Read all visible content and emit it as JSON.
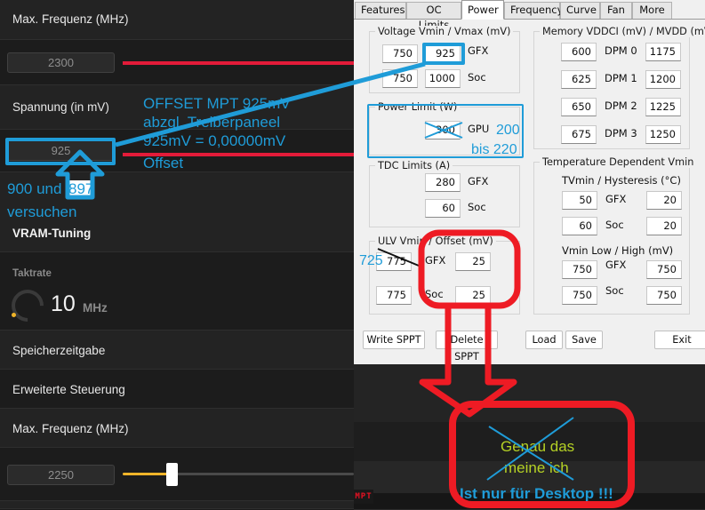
{
  "left_panel": {
    "rows": [
      {
        "label": "Max. Frequenz (MHz)"
      },
      {
        "value": "2300"
      },
      {
        "label": "Spannung (in mV)"
      },
      {
        "value": "925"
      },
      {
        "label": "VRAM-Tuning"
      },
      {
        "label": "Taktrate",
        "value": "10",
        "unit": "MHz"
      },
      {
        "label": "Speicherzeitgabe"
      },
      {
        "label": "Erweiterte Steuerung"
      },
      {
        "label": "Max. Frequenz (MHz)"
      },
      {
        "value": "2250"
      }
    ],
    "max_freq_label_top": "Max. Frequenz (MHz)",
    "max_freq_value_top": "2300",
    "voltage_label": "Spannung (in mV)",
    "voltage_value": "925",
    "vram_tuning_label": "VRAM-Tuning",
    "taktrate_label": "Taktrate",
    "taktrate_value": "10",
    "taktrate_unit": "MHz",
    "memory_timing_label": "Speicherzeitgabe",
    "advanced_control_label": "Erweiterte Steuerung",
    "max_freq_label_bottom": "Max. Frequenz (MHz)",
    "max_freq_value_bottom": "2250"
  },
  "mpt": {
    "tabs": [
      {
        "label": "Features",
        "selected": false
      },
      {
        "label": "OC Limits",
        "selected": false
      },
      {
        "label": "Power",
        "selected": true
      },
      {
        "label": "Frequency",
        "selected": false
      },
      {
        "label": "Curve",
        "selected": false
      },
      {
        "label": "Fan",
        "selected": false
      },
      {
        "label": "More",
        "selected": false
      }
    ],
    "voltage_group": {
      "title": "Voltage Vmin / Vmax (mV)",
      "rows": [
        {
          "min": "750",
          "max": "925",
          "label": "GFX"
        },
        {
          "min": "750",
          "max": "1000",
          "label": "Soc"
        }
      ]
    },
    "power_limit_group": {
      "title": "Power Limit (W)",
      "value": "300",
      "label": "GPU"
    },
    "tdc_group": {
      "title": "TDC Limits (A)",
      "rows": [
        {
          "value": "280",
          "label": "GFX"
        },
        {
          "value": "60",
          "label": "Soc"
        }
      ]
    },
    "ulv_group": {
      "title": "ULV Vmin / Offset (mV)",
      "rows": [
        {
          "vmin": "775",
          "label": "GFX",
          "offset": "25"
        },
        {
          "vmin": "775",
          "label": "Soc",
          "offset": "25"
        }
      ]
    },
    "memory_group": {
      "title": "Memory VDDCI (mV) / MVDD (mV)",
      "rows": [
        {
          "vddci": "600",
          "label": "DPM 0",
          "mvdd": "1175"
        },
        {
          "vddci": "625",
          "label": "DPM 1",
          "mvdd": "1200"
        },
        {
          "vddci": "650",
          "label": "DPM 2",
          "mvdd": "1225"
        },
        {
          "vddci": "675",
          "label": "DPM 3",
          "mvdd": "1250"
        }
      ]
    },
    "temp_group": {
      "title": "Temperature Dependent Vmin",
      "tvmin_header": "TVmin / Hysteresis (°C)",
      "tvmin_rows": [
        {
          "tvmin": "50",
          "label": "GFX",
          "hyst": "20"
        },
        {
          "tvmin": "60",
          "label": "Soc",
          "hyst": "20"
        }
      ],
      "vmin_header": "Vmin Low / High (mV)",
      "vmin_rows": [
        {
          "low": "750",
          "label": "GFX",
          "high": "750"
        },
        {
          "low": "750",
          "label": "Soc",
          "high": "750"
        }
      ]
    },
    "buttons": [
      {
        "label": "Write SPPT"
      },
      {
        "label": "Delete SPPT"
      },
      {
        "label": "Load"
      },
      {
        "label": "Save"
      },
      {
        "label": "Exit"
      }
    ]
  },
  "annotations": {
    "offset_note_line1": "OFFSET MPT 925mV",
    "offset_note_line2": "abzgl. Treiberpaneel",
    "offset_note_line3": "925mV = 0,00000mV",
    "offset_note_line4": "Offset",
    "try_line1_pre": "900 und ",
    "try_highlight": "897",
    "try_line2": "versuchen",
    "power_new_value": "200",
    "power_upto": "bis 220",
    "ulv_new_value": "725",
    "bottom_green": [
      "Genau das",
      "meine ich"
    ],
    "bottom_blue": "Ist nur für Desktop !!!",
    "taskbar_icon": "MPT"
  },
  "colors": {
    "annotation_blue": "#1f9cd8",
    "annotation_red": "#e31b39",
    "annotation_green": "#b5d125",
    "slider_accent": "#f0b429"
  }
}
